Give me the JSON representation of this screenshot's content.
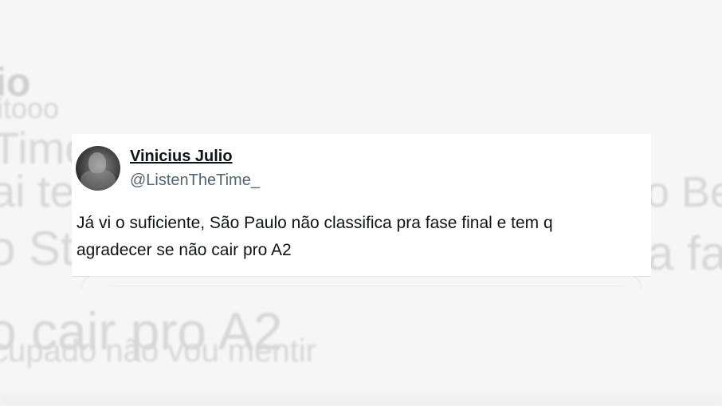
{
  "tweet": {
    "author_name": "Vinicius Julio",
    "author_handle": "@ListenTheTime_",
    "text_line1": "Já vi o suficiente, São Paulo não classifica pra fase final e tem q",
    "text_line2": "agradecer se não cair pro A2",
    "avatar_icon": "profile-avatar"
  },
  "background": {
    "name_fragment": "io",
    "handle_fragment": "itooo",
    "time_fragment": "Time",
    "line1_left": "ai te",
    "line1_right": "o Ber",
    "line2_left": "o St S",
    "line2_right": "a fa",
    "line3": "o cair pro A2",
    "line4": "cupado não vou mentir"
  }
}
